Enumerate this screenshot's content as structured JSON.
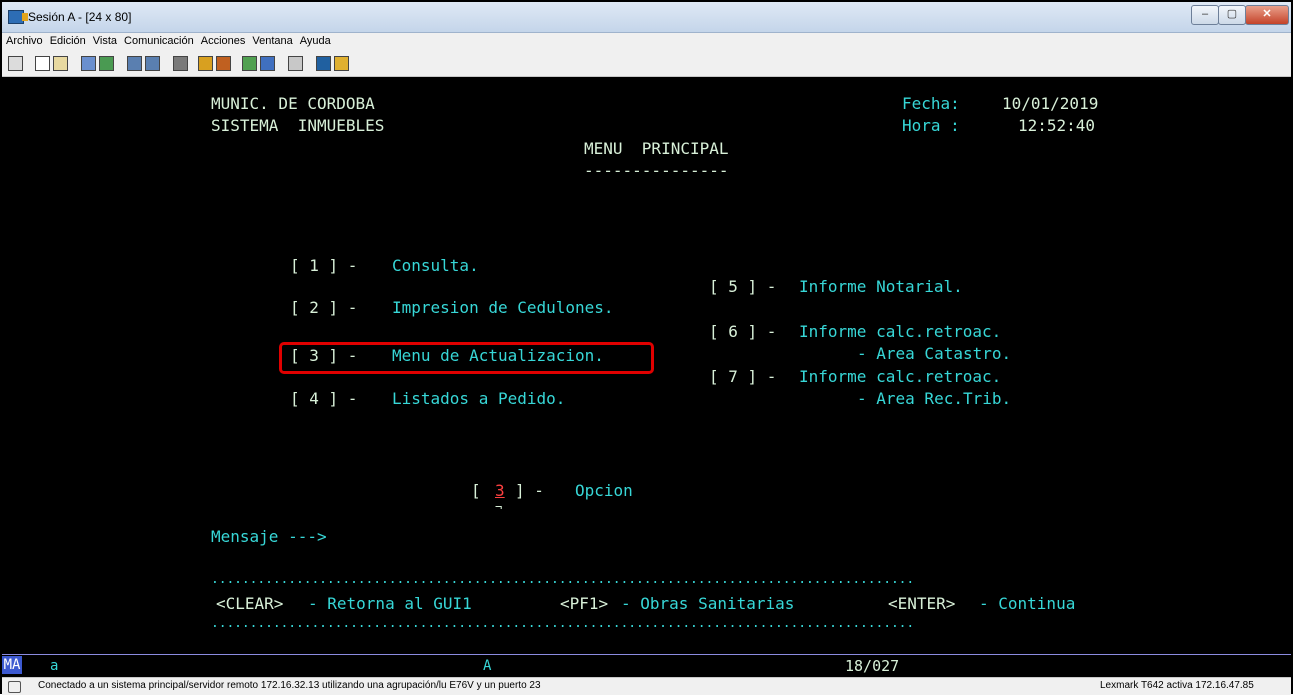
{
  "window": {
    "title": "Sesión A - [24 x 80]"
  },
  "menu": [
    "Archivo",
    "Edición",
    "Vista",
    "Comunicación",
    "Acciones",
    "Ventana",
    "Ayuda"
  ],
  "terminal": {
    "org": "MUNIC. DE CORDOBA",
    "system": "SISTEMA  INMUEBLES",
    "date_label": "Fecha:",
    "date": "10/01/2019",
    "time_label": "Hora :",
    "time": "12:52:40",
    "heading": "MENU  PRINCIPAL",
    "heading_underline": "---------------",
    "options_left": [
      {
        "key": "[ 1 ] -",
        "label": "Consulta."
      },
      {
        "key": "[ 2 ] -",
        "label": "Impresion de Cedulones."
      },
      {
        "key": "[ 3 ] -",
        "label": "Menu de Actualizacion."
      },
      {
        "key": "[ 4 ] -",
        "label": "Listados a Pedido."
      }
    ],
    "options_right": [
      {
        "key": "[ 5 ] -",
        "label": "Informe Notarial."
      },
      {
        "key": "[ 6 ] -",
        "label": "Informe calc.retroac.",
        "sub": "- Area Catastro."
      },
      {
        "key": "[ 7 ] -",
        "label": "Informe calc.retroac.",
        "sub": "- Area Rec.Trib."
      }
    ],
    "prompt_open": "[",
    "option_value": "3",
    "prompt_close": "] -",
    "prompt_label": "Opcion",
    "message_label": "Mensaje --->",
    "dots": "...........................................................................................",
    "fkeys": [
      {
        "key": "<CLEAR>",
        "label": "- Retorna al GUI1"
      },
      {
        "key": "<PF1>",
        "label": "- Obras Sanitarias"
      },
      {
        "key": "<ENTER>",
        "label": "- Continua"
      }
    ]
  },
  "oia": {
    "mode": "MA",
    "session": "a",
    "keyboard": "A",
    "cursor": "18/027"
  },
  "status": {
    "connection": "Conectado a un sistema principal/servidor remoto 172.16.32.13 utilizando una agrupación/lu E76V y un puerto 23",
    "printer": "Lexmark T642 activa 172.16.47.85"
  },
  "colors": {
    "terminal_bg": "#000000",
    "text_green": "#d8f0d8",
    "text_cyan": "#37d7d7",
    "input_red": "#ff4040",
    "highlight": "#e00000"
  }
}
